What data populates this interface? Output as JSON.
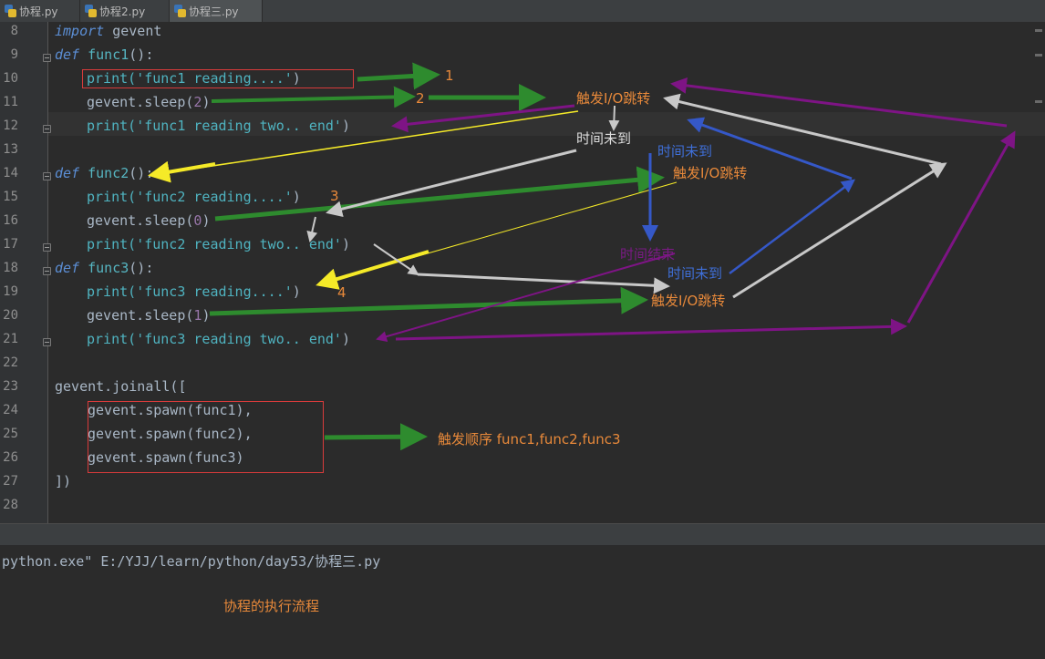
{
  "tabs": [
    {
      "label": "协程.py",
      "active": false
    },
    {
      "label": "协程2.py",
      "active": false
    },
    {
      "label": "协程三.py",
      "active": true
    }
  ],
  "line_numbers": [
    "8",
    "9",
    "10",
    "11",
    "12",
    "13",
    "14",
    "15",
    "16",
    "17",
    "18",
    "19",
    "20",
    "21",
    "22",
    "23",
    "24",
    "25",
    "26",
    "27",
    "28"
  ],
  "code": {
    "l8_kw": "import",
    "l8_rest": " gevent",
    "l9_kw": "def",
    "l9_fn": "func1",
    "l9_rest": "():",
    "l10_a": "print(",
    "l10_s": "'func1 reading....'",
    "l10_b": ")",
    "l11_a": "gevent.sleep(",
    "l11_n": "2",
    "l11_b": ")",
    "l12_a": "print(",
    "l12_s": "'func1 reading two.. end'",
    "l12_b": ")",
    "l14_kw": "def",
    "l14_fn": "func2",
    "l14_rest": "():",
    "l15_a": "print(",
    "l15_s": "'func2 reading....'",
    "l15_b": ")",
    "l16_a": "gevent.sleep(",
    "l16_n": "0",
    "l16_b": ")",
    "l17_a": "print(",
    "l17_s": "'func2 reading two.. end'",
    "l17_b": ")",
    "l18_kw": "def",
    "l18_fn": "func3",
    "l18_rest": "():",
    "l19_a": "print(",
    "l19_s": "'func3 reading....'",
    "l19_b": ")",
    "l20_a": "gevent.sleep(",
    "l20_n": "1",
    "l20_b": ")",
    "l21_a": "print(",
    "l21_s": "'func3 reading two.. end'",
    "l21_b": ")",
    "l23": "gevent.joinall([",
    "l24": "gevent.spawn(func1),",
    "l25": "gevent.spawn(func2),",
    "l26": "gevent.spawn(func3)",
    "l27": "])"
  },
  "annotations": {
    "n1": "1",
    "n2": "2",
    "n3": "3",
    "n4": "4",
    "trigger_io_1": "触发I/O跳转",
    "time_not_up_1": "时间未到",
    "time_not_up_blue_1": "时间未到",
    "trigger_io_2": "触发I/O跳转",
    "time_ended": "时间结束",
    "time_not_up_blue_2": "时间未到",
    "trigger_io_3": "触发I/O跳转",
    "trigger_order": "触发顺序 func1,func2,func3",
    "flow_caption": "协程的执行流程"
  },
  "console": {
    "command": "python.exe\" E:/YJJ/learn/python/day53/协程三.py"
  },
  "colors": {
    "background": "#2b2b2b",
    "annotation_orange": "#e8893a",
    "annotation_white": "#dddddd",
    "annotation_blue": "#3f6fd8",
    "annotation_purple": "#7a1a84",
    "arrow_green": "#2e8b2e",
    "arrow_yellow": "#f5ea28",
    "arrow_gray": "#c8c8c8",
    "arrow_blue": "#3558c8",
    "arrow_purple": "#7e1485",
    "box_red": "#d83b3b"
  }
}
